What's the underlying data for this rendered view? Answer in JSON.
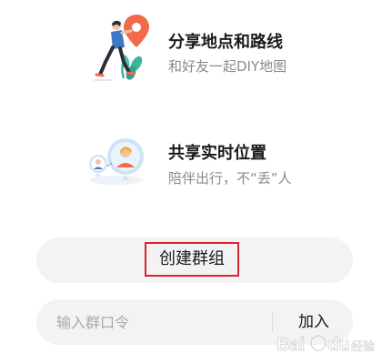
{
  "features": [
    {
      "title": "分享地点和路线",
      "subtitle": "和好友一起DIY地图",
      "illustration": "share-route-illustration"
    },
    {
      "title": "共享实时位置",
      "subtitle": "陪伴出行，不“丢”人",
      "illustration": "realtime-location-illustration"
    }
  ],
  "create_group": {
    "label": "创建群组"
  },
  "join_group": {
    "placeholder": "输入群口令",
    "button_label": "加入"
  },
  "watermark": {
    "text": "Bai du 经验"
  },
  "colors": {
    "accent": "#f4694a",
    "highlight_border": "#d9262c",
    "button_bg": "#f3f3f3",
    "plant": "#3cb5a0"
  }
}
